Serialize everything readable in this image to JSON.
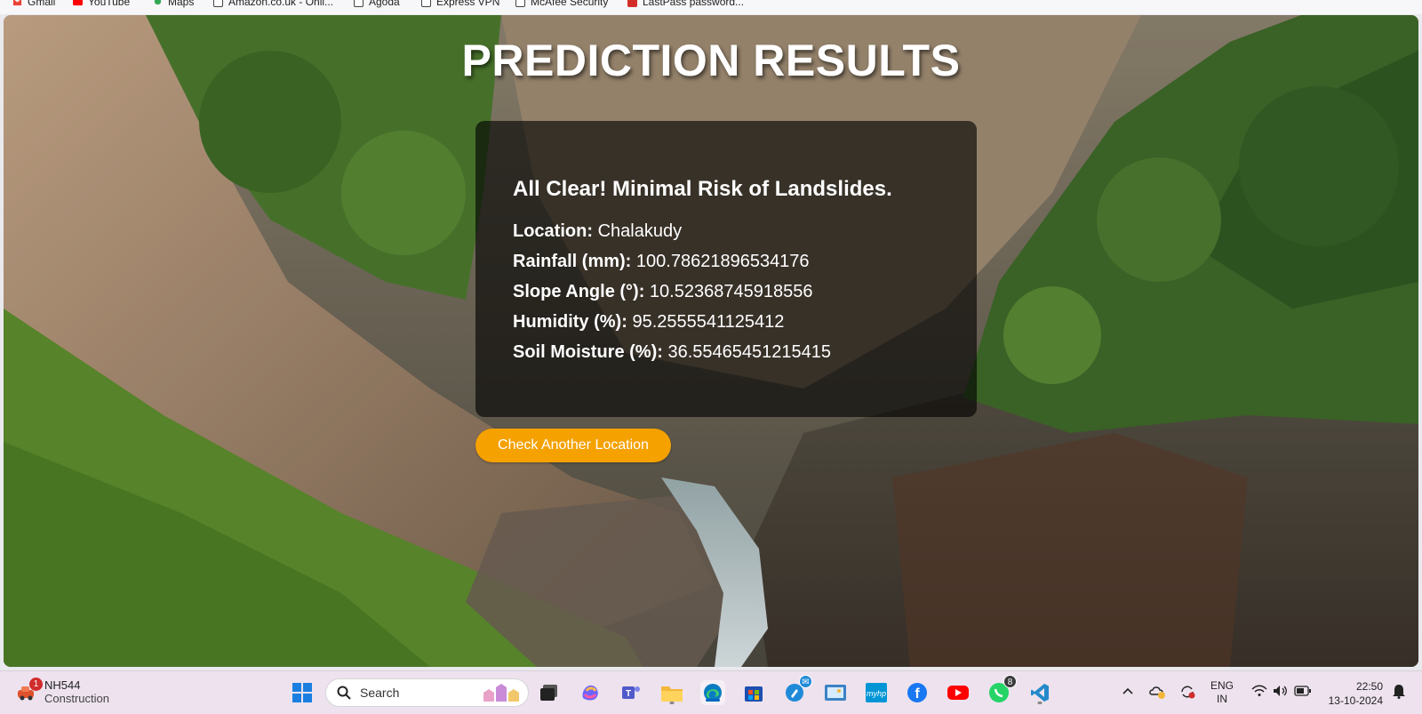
{
  "bookmarks": [
    {
      "label": "Gmail",
      "icon": "gmail-icon"
    },
    {
      "label": "YouTube",
      "icon": "youtube-icon"
    },
    {
      "label": "Maps",
      "icon": "maps-icon"
    },
    {
      "label": "Amazon.co.uk - Onli...",
      "icon": "page-icon"
    },
    {
      "label": "Agoda",
      "icon": "page-icon"
    },
    {
      "label": "Express VPN",
      "icon": "page-icon"
    },
    {
      "label": "McAfee Security",
      "icon": "page-icon"
    },
    {
      "label": "LastPass password...",
      "icon": "lastpass-icon"
    }
  ],
  "page": {
    "title": "PREDICTION RESULTS",
    "result_heading": "All Clear! Minimal Risk of Landslides.",
    "fields": [
      {
        "label": "Location:",
        "value": "Chalakudy"
      },
      {
        "label": "Rainfall (mm):",
        "value": "100.78621896534176"
      },
      {
        "label": "Slope Angle (°):",
        "value": "10.52368745918556"
      },
      {
        "label": "Humidity (%):",
        "value": "95.2555541125412"
      },
      {
        "label": "Soil Moisture (%):",
        "value": "36.55465451215415"
      }
    ],
    "button_label": "Check Another Location",
    "accent_color": "#f5a100"
  },
  "taskbar": {
    "weather": {
      "badge": "1",
      "title": "NH544",
      "subtitle": "Construction"
    },
    "search_placeholder": "Search",
    "apps": [
      "windows-start-icon",
      "file-explorer-icon",
      "copilot-icon",
      "teams-icon",
      "folder-icon",
      "edge-icon",
      "store-icon",
      "messaging-icon",
      "photos-icon",
      "myhp-icon",
      "facebook-icon",
      "youtube-icon",
      "whatsapp-icon",
      "vscode-icon"
    ],
    "whatsapp_badge": "8",
    "language": {
      "line1": "ENG",
      "line2": "IN"
    },
    "clock": {
      "time": "22:50",
      "date": "13-10-2024"
    }
  }
}
